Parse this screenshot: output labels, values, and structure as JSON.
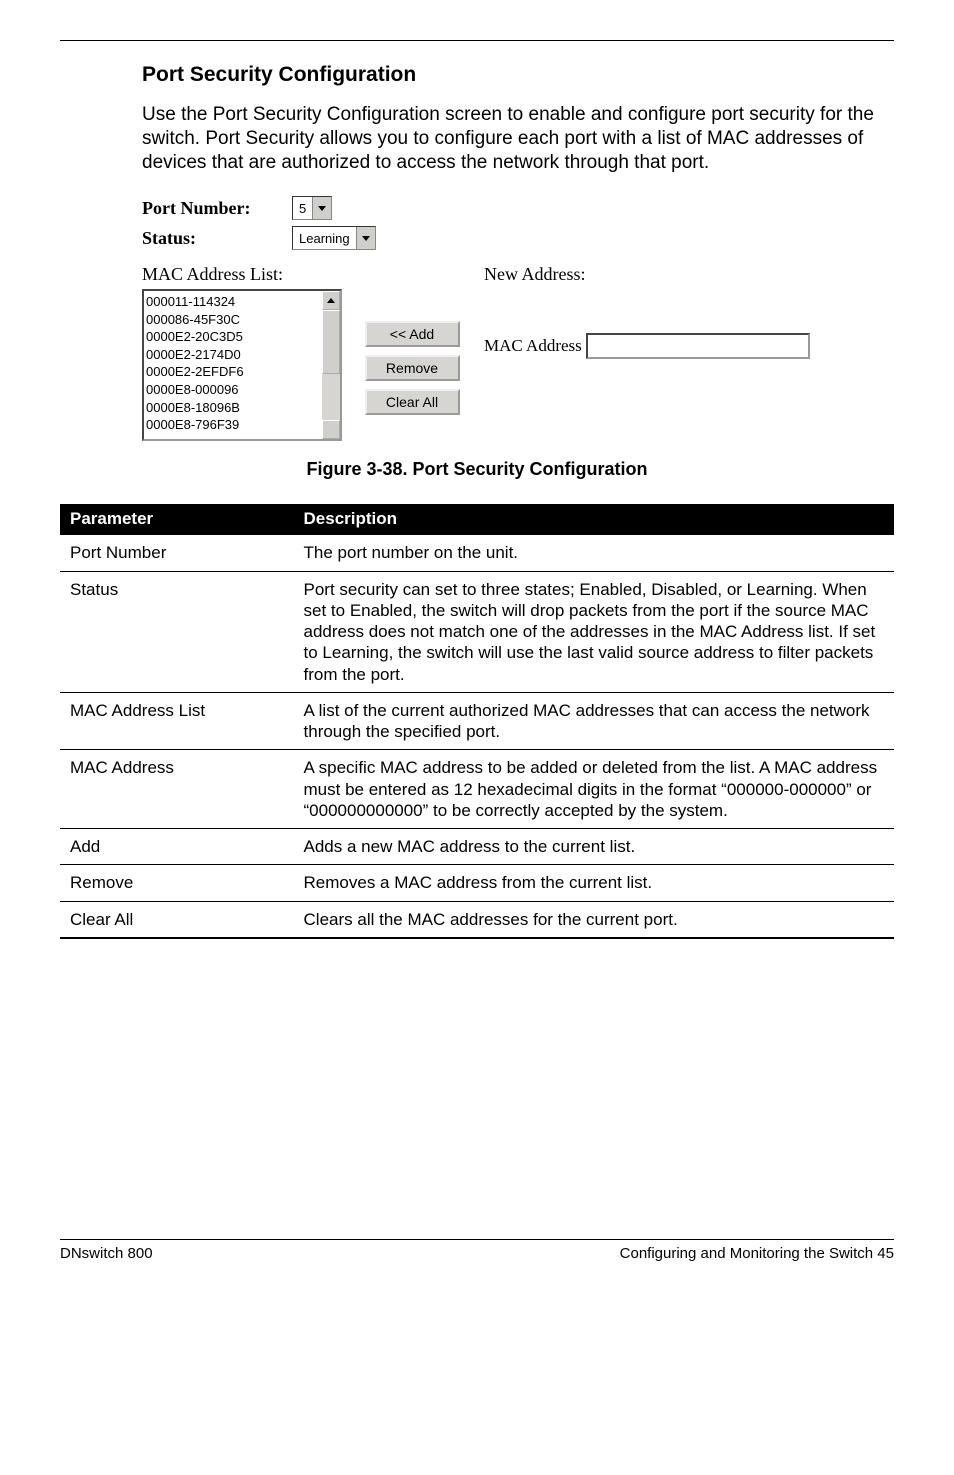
{
  "title": "Port Security Configuration",
  "intro": "Use the Port Security Configuration screen to enable and configure port security for the switch. Port Security allows you to configure each port with a list of MAC addresses of devices that are authorized to access the network through that port.",
  "form": {
    "port_number_label": "Port Number:",
    "port_number_value": "5",
    "status_label": "Status:",
    "status_value": "Learning",
    "mac_list_label": "MAC Address List:",
    "new_address_label": "New Address:",
    "mac_address_label": "MAC Address",
    "add_btn": "<< Add",
    "remove_btn": "Remove",
    "clear_all_btn": "Clear All",
    "mac_items": [
      "000011-114324",
      "000086-45F30C",
      "0000E2-20C3D5",
      "0000E2-2174D0",
      "0000E2-2EFDF6",
      "0000E8-000096",
      "0000E8-18096B",
      "0000E8-796F39"
    ]
  },
  "figure_caption": "Figure 3-38.  Port Security Configuration",
  "table": {
    "headers": {
      "param": "Parameter",
      "desc": "Description"
    },
    "rows": [
      {
        "param": "Port Number",
        "desc": "The port number on the unit."
      },
      {
        "param": "Status",
        "desc": "Port security can set to three states; Enabled, Disabled, or Learning. When set to Enabled, the switch will drop packets from the port if the source MAC address does not match one of the addresses in the MAC Address list. If set to Learning, the switch will use the last valid source address to filter packets from the port."
      },
      {
        "param": "MAC Address List",
        "desc": "A list of the current authorized MAC addresses that can access the network through the specified port."
      },
      {
        "param": "MAC Address",
        "desc": "A specific MAC address to be added or deleted from the list. A MAC address must be entered as 12 hexadecimal digits in the format “000000-000000” or “000000000000” to be correctly accepted by the system."
      },
      {
        "param": "Add",
        "desc": "Adds a new MAC address to the current list."
      },
      {
        "param": "Remove",
        "desc": "Removes a MAC address from the current list."
      },
      {
        "param": "Clear All",
        "desc": "Clears all the MAC addresses for the current port."
      }
    ]
  },
  "footer": {
    "left": "DNswitch 800",
    "right": "Configuring and Monitoring the Switch  45"
  }
}
